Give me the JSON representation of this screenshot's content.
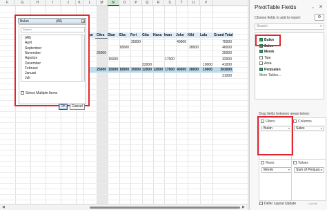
{
  "columns": [
    "F",
    "G",
    "H",
    "I",
    "J",
    "K",
    "L",
    "M",
    "N",
    "O",
    "P",
    "Q",
    "R",
    "S",
    "T",
    "U",
    "V"
  ],
  "pivot": {
    "row_label": "Bulan",
    "headers": [
      "Citra",
      "Dian",
      "Eka",
      "Feri",
      "Gita",
      "Hana",
      "Iwan",
      "Joko",
      "Kiki",
      "Lala",
      "Grand Total"
    ],
    "rows": [
      [
        "",
        "",
        "",
        "35000",
        "",
        "",
        "",
        "40000",
        "",
        "",
        "75000"
      ],
      [
        "",
        "",
        "18000",
        "",
        "",
        "",
        "",
        "",
        "28000",
        "",
        "46000"
      ],
      [
        "25000",
        "",
        "",
        "",
        "",
        "",
        "",
        "",
        "",
        "",
        "25000"
      ],
      [
        "",
        "15000",
        "",
        "",
        "",
        "",
        "17000",
        "",
        "",
        "",
        "32000"
      ],
      [
        "",
        "",
        "",
        "",
        "22000",
        "",
        "",
        "",
        "",
        "19000",
        "41000"
      ],
      [
        "",
        "",
        "",
        "",
        "",
        "",
        "",
        "",
        "",
        "",
        "12000"
      ],
      [
        "",
        "",
        "",
        "",
        "",
        "",
        "",
        "",
        "",
        "",
        "21000"
      ]
    ],
    "total": [
      "25000",
      "15000",
      "18000",
      "35000",
      "22000",
      "12000",
      "17000",
      "40000",
      "28000",
      "19000",
      "263000"
    ]
  },
  "filter": {
    "label": "Bulan",
    "value": "(All)",
    "search_placeholder": "Search",
    "items": [
      "(All)",
      "April",
      "September",
      "November",
      "Agustus",
      "Desember",
      "Februari",
      "Januari",
      "Juli"
    ],
    "multi_label": "Select Multiple Items",
    "ok": "OK",
    "cancel": "Cancel"
  },
  "pane": {
    "title": "PivotTable Fields",
    "subtitle": "Choose fields to add to report:",
    "search_placeholder": "Search",
    "fields": [
      {
        "label": "Bulan",
        "checked": true,
        "bold": true
      },
      {
        "label": "Sales",
        "checked": true,
        "bold": true
      },
      {
        "label": "Merek",
        "checked": true,
        "bold": true
      },
      {
        "label": "Tipe",
        "checked": false,
        "bold": false
      },
      {
        "label": "Area",
        "checked": false,
        "bold": false
      },
      {
        "label": "Penjualan",
        "checked": true,
        "bold": true
      }
    ],
    "more_tables": "More Tables...",
    "drag_label": "Drag fields between areas below:",
    "areas": {
      "filters": {
        "title": "Filters",
        "item": "Bulan"
      },
      "columns": {
        "title": "Columns",
        "item": "Sales"
      },
      "rows": {
        "title": "Rows",
        "item": "Merek"
      },
      "values": {
        "title": "Values",
        "item": "Sum of Penjual..."
      }
    },
    "defer_label": "Defer Layout Update",
    "update_label": "Update"
  }
}
